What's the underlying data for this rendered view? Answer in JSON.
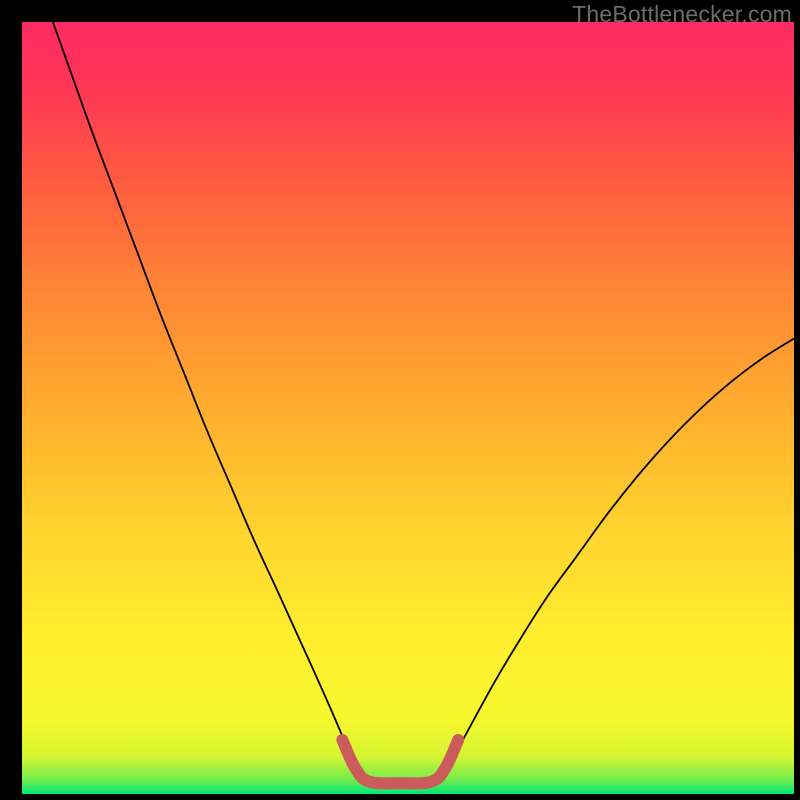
{
  "watermark": "TheBottlenecker.com",
  "chart_data": {
    "type": "line",
    "title": "",
    "xlabel": "",
    "ylabel": "",
    "xlim": [
      0,
      100
    ],
    "ylim": [
      0,
      100
    ],
    "grid": false,
    "background_gradient": {
      "stops": [
        {
          "offset": 0.0,
          "color": "#00e676"
        },
        {
          "offset": 0.02,
          "color": "#7aee4a"
        },
        {
          "offset": 0.05,
          "color": "#d7f531"
        },
        {
          "offset": 0.1,
          "color": "#f8f82e"
        },
        {
          "offset": 0.2,
          "color": "#ffee2e"
        },
        {
          "offset": 0.35,
          "color": "#ffd22e"
        },
        {
          "offset": 0.5,
          "color": "#ffad2f"
        },
        {
          "offset": 0.65,
          "color": "#ff8636"
        },
        {
          "offset": 0.8,
          "color": "#ff5a41"
        },
        {
          "offset": 0.92,
          "color": "#ff3556"
        },
        {
          "offset": 1.0,
          "color": "#ff2a63"
        }
      ]
    },
    "series": [
      {
        "name": "left-curve",
        "stroke": "#000000",
        "width": 1.8,
        "points": [
          {
            "x": 4.0,
            "y": 100.0
          },
          {
            "x": 6.5,
            "y": 93.0
          },
          {
            "x": 9.0,
            "y": 86.0
          },
          {
            "x": 12.0,
            "y": 78.0
          },
          {
            "x": 15.0,
            "y": 70.0
          },
          {
            "x": 18.0,
            "y": 62.0
          },
          {
            "x": 21.0,
            "y": 54.5
          },
          {
            "x": 24.0,
            "y": 47.0
          },
          {
            "x": 27.0,
            "y": 40.0
          },
          {
            "x": 30.0,
            "y": 33.0
          },
          {
            "x": 33.0,
            "y": 26.5
          },
          {
            "x": 35.5,
            "y": 21.0
          },
          {
            "x": 38.0,
            "y": 15.5
          },
          {
            "x": 40.0,
            "y": 11.0
          },
          {
            "x": 41.5,
            "y": 7.5
          },
          {
            "x": 42.8,
            "y": 4.5
          },
          {
            "x": 43.8,
            "y": 2.3
          }
        ]
      },
      {
        "name": "right-curve",
        "stroke": "#000000",
        "width": 1.8,
        "points": [
          {
            "x": 54.5,
            "y": 2.3
          },
          {
            "x": 55.5,
            "y": 4.0
          },
          {
            "x": 57.0,
            "y": 6.8
          },
          {
            "x": 59.0,
            "y": 10.5
          },
          {
            "x": 61.5,
            "y": 15.0
          },
          {
            "x": 64.5,
            "y": 20.0
          },
          {
            "x": 68.0,
            "y": 25.5
          },
          {
            "x": 72.0,
            "y": 31.0
          },
          {
            "x": 76.0,
            "y": 36.5
          },
          {
            "x": 80.0,
            "y": 41.5
          },
          {
            "x": 84.0,
            "y": 46.0
          },
          {
            "x": 88.0,
            "y": 50.0
          },
          {
            "x": 92.0,
            "y": 53.5
          },
          {
            "x": 96.0,
            "y": 56.5
          },
          {
            "x": 100.0,
            "y": 59.0
          }
        ]
      },
      {
        "name": "bottom-trough",
        "stroke": "#cc5c5c",
        "width": 12,
        "linecap": "round",
        "points": [
          {
            "x": 41.5,
            "y": 7.0
          },
          {
            "x": 43.2,
            "y": 3.3
          },
          {
            "x": 45.0,
            "y": 1.6
          },
          {
            "x": 49.0,
            "y": 1.4
          },
          {
            "x": 53.0,
            "y": 1.6
          },
          {
            "x": 54.8,
            "y": 3.3
          },
          {
            "x": 56.5,
            "y": 7.0
          }
        ]
      }
    ]
  }
}
